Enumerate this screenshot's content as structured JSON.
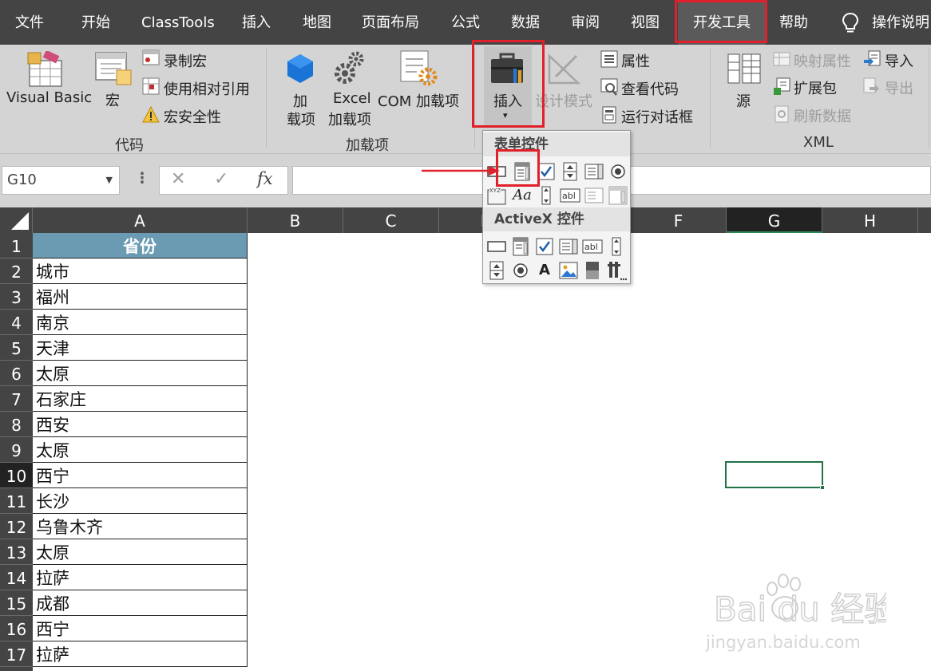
{
  "menu": {
    "tabs": [
      {
        "label": "文件"
      },
      {
        "label": "开始"
      },
      {
        "label": "ClassTools"
      },
      {
        "label": "插入"
      },
      {
        "label": "地图"
      },
      {
        "label": "页面布局"
      },
      {
        "label": "公式"
      },
      {
        "label": "数据"
      },
      {
        "label": "审阅"
      },
      {
        "label": "视图"
      },
      {
        "label": "开发工具"
      },
      {
        "label": "帮助"
      }
    ],
    "active_tab": "开发工具",
    "tell_me": "操作说明"
  },
  "ribbon": {
    "code": {
      "label": "代码",
      "visual_basic": "Visual Basic",
      "macros": "宏",
      "record_macro": "录制宏",
      "relative_refs": "使用相对引用",
      "macro_security": "宏安全性"
    },
    "addins": {
      "label": "加载项",
      "addins_line1": "加",
      "addins_line2": "载项",
      "excel_addins_line1": "Excel",
      "excel_addins_line2": "加载项",
      "com_addins": "COM 加载项"
    },
    "controls": {
      "insert": "插入",
      "design_mode": "设计模式",
      "properties": "属性",
      "view_code": "查看代码",
      "run_dialog": "运行对话框"
    },
    "xml": {
      "label": "XML",
      "source": "源",
      "map_properties": "映射属性",
      "expansion_packs": "扩展包",
      "refresh_data": "刷新数据",
      "import": "导入",
      "export": "导出"
    }
  },
  "formula_bar": {
    "name_box": "G10",
    "fx": "fx",
    "cancel_icon": "✕",
    "enter_icon": "✓",
    "formula": ""
  },
  "dropdown": {
    "form_controls_title": "表单控件",
    "activex_title": "ActiveX 控件",
    "form_label_text": "Aa",
    "form_group_text": "XYZ",
    "textbox_text": "abl",
    "activex_label_text": "A"
  },
  "sheet": {
    "columns": [
      "A",
      "B",
      "C",
      "D",
      "E",
      "F",
      "G",
      "H"
    ],
    "selected_column": "G",
    "selected_row": "10",
    "rows": [
      {
        "num": "1",
        "a": "省份"
      },
      {
        "num": "2",
        "a": "城市"
      },
      {
        "num": "3",
        "a": "福州"
      },
      {
        "num": "4",
        "a": "南京"
      },
      {
        "num": "5",
        "a": "天津"
      },
      {
        "num": "6",
        "a": "太原"
      },
      {
        "num": "7",
        "a": "石家庄"
      },
      {
        "num": "8",
        "a": "西安"
      },
      {
        "num": "9",
        "a": "太原"
      },
      {
        "num": "10",
        "a": "西宁"
      },
      {
        "num": "11",
        "a": "长沙"
      },
      {
        "num": "12",
        "a": "乌鲁木齐"
      },
      {
        "num": "13",
        "a": "太原"
      },
      {
        "num": "14",
        "a": "拉萨"
      },
      {
        "num": "15",
        "a": "成都"
      },
      {
        "num": "16",
        "a": "西宁"
      },
      {
        "num": "17",
        "a": "拉萨"
      }
    ]
  },
  "watermark": {
    "brand": "Bai du 经验",
    "url": "jingyan.baidu.com"
  },
  "colors": {
    "menubar": "#444444",
    "ribbon": "#d4d4d4",
    "header_fill": "#6b9bb3",
    "selection": "#217346",
    "highlight": "#e0202a"
  }
}
